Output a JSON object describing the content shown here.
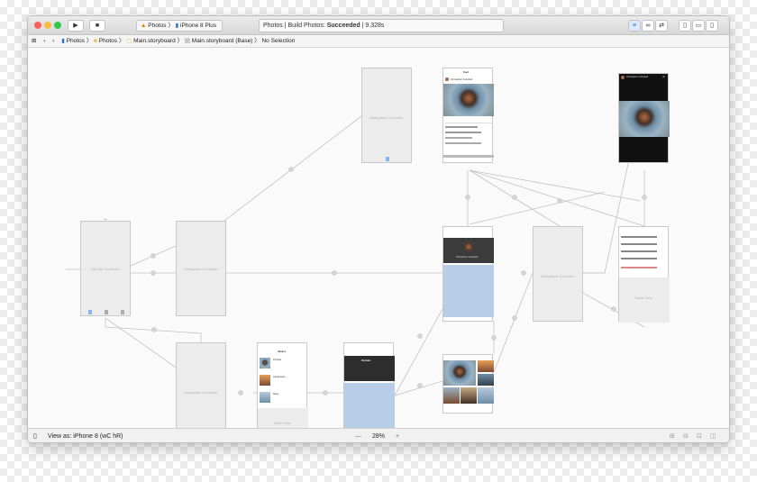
{
  "window": {
    "run_icon": "play-icon",
    "stop_icon": "stop-icon",
    "scheme": {
      "app": "Photos",
      "device": "iPhone 8 Plus"
    },
    "status": {
      "project": "Photos",
      "label": "Build Photos:",
      "result": "Succeeded",
      "time": "9.328s"
    }
  },
  "jumpbar": {
    "crumbs": [
      "Photos",
      "Photos",
      "Main.storyboard",
      "Main.storyboard (Base)",
      "No Selection"
    ]
  },
  "scenes": {
    "tab_bar": {
      "label": "Tab Bar Controller"
    },
    "nav1": {
      "label": "Navigation Controller"
    },
    "nav2": {
      "label": "Navigation Controller"
    },
    "nav3": {
      "label": "Navigation Controller"
    },
    "nav4": {
      "label": "Navigation Controller"
    },
    "feed": {
      "title": "Feed",
      "author": "Christopher Campbell"
    },
    "profile": {
      "name": "Christopher Campbell"
    },
    "albums": {
      "title": "Albums",
      "items": [
        "Portraits",
        "Landscapes",
        "Skies"
      ]
    },
    "album_detail": {
      "title": "Portraits"
    },
    "comments_table": {
      "label": "Table View"
    },
    "albums_table": {
      "label": "Table View"
    }
  },
  "bottombar": {
    "view_as": "View as: iPhone 8 (wC hR)",
    "zoom_out": "—",
    "zoom": "28%",
    "zoom_in": "+"
  }
}
